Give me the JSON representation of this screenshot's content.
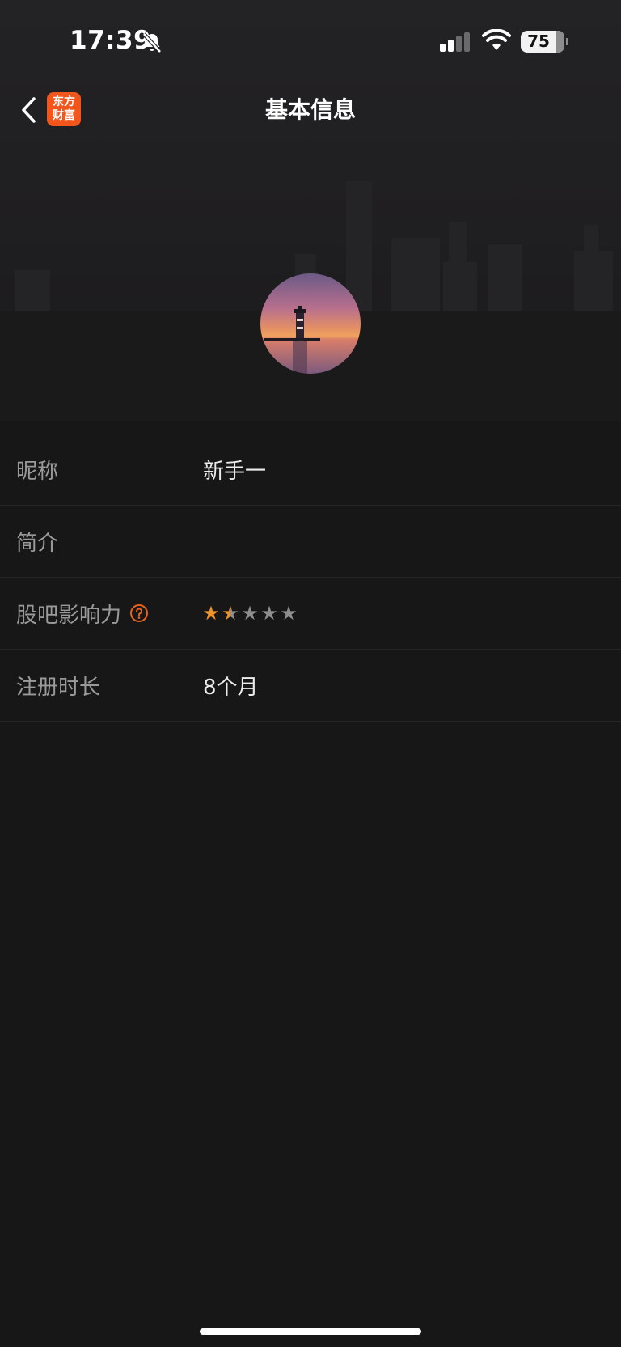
{
  "status_bar": {
    "time": "17:39",
    "battery": "75",
    "icons": [
      "bell-slash-icon",
      "cellular-signal-icon",
      "wifi-icon",
      "battery-icon"
    ]
  },
  "nav": {
    "title": "基本信息",
    "back_icon": "chevron-left-icon",
    "logo_line1": "东方",
    "logo_line2": "财富",
    "logo_color": "#f2561d"
  },
  "profile": {
    "avatar": "lighthouse-sunset-avatar"
  },
  "info": {
    "nickname": {
      "label": "昵称",
      "value": "新手一"
    },
    "bio": {
      "label": "简介",
      "value": ""
    },
    "influence": {
      "label": "股吧影响力",
      "rating": 1.5,
      "max": 5,
      "help_icon": "question-circle-icon",
      "star_color": "#f0922a"
    },
    "registered": {
      "label": "注册时长",
      "value": "8个月"
    }
  },
  "colors": {
    "background": "#181718",
    "accent": "#f0922a",
    "label": "#9a9a9a"
  }
}
